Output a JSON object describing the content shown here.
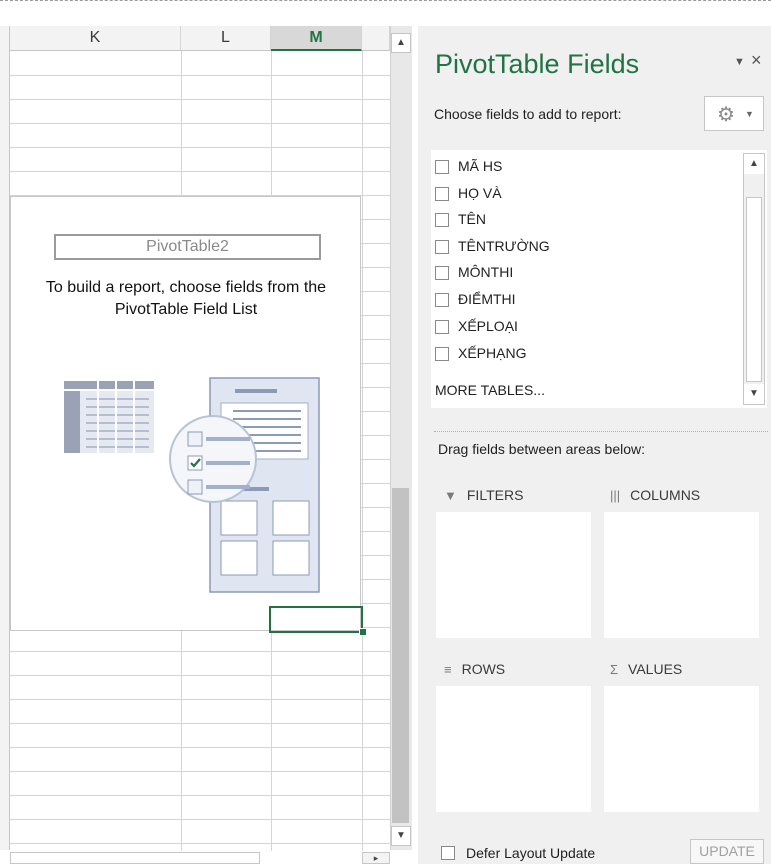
{
  "sheet": {
    "columns": [
      "K",
      "L",
      "M"
    ],
    "selected_column": "M",
    "pivot_placeholder": {
      "name": "PivotTable2",
      "message": "To build a report, choose fields from the PivotTable Field List"
    }
  },
  "pane": {
    "title": "PivotTable Fields",
    "pin_icon": "dropdown-arrow-icon",
    "close_icon": "close-icon",
    "choose_label": "Choose fields to add to report:",
    "gear_icon": "gear-icon",
    "fields": [
      {
        "label": "MÃ HS",
        "checked": false
      },
      {
        "label": "HỌ VÀ",
        "checked": false
      },
      {
        "label": "TÊN",
        "checked": false
      },
      {
        "label": "TÊNTRƯỜNG",
        "checked": false
      },
      {
        "label": "MÔNTHI",
        "checked": false
      },
      {
        "label": "ĐIỂMTHI",
        "checked": false
      },
      {
        "label": "XẾPLOẠI",
        "checked": false
      },
      {
        "label": "XẾPHẠNG",
        "checked": false
      }
    ],
    "more_tables": "MORE TABLES...",
    "drag_label": "Drag fields between areas below:",
    "areas": {
      "filters": "FILTERS",
      "columns": "COLUMNS",
      "rows": "ROWS",
      "values": "VALUES"
    },
    "defer_label": "Defer Layout Update",
    "update_label": "UPDATE"
  },
  "colors": {
    "accent": "#217346",
    "pane_bg": "#f0f0f0"
  }
}
